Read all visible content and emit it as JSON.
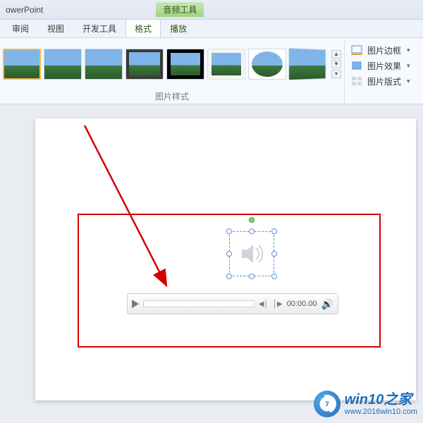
{
  "app_title": "owerPoint",
  "context_tab": "音频工具",
  "tabs": {
    "review": "审阅",
    "view": "视图",
    "dev": "开发工具",
    "format": "格式",
    "playback": "播放"
  },
  "ribbon": {
    "styles_label": "图片样式",
    "opts": {
      "border": "图片边框",
      "effects": "图片效果",
      "layout": "图片版式"
    }
  },
  "audio": {
    "time": "00:00.00"
  },
  "watermark": {
    "title": "win10之家",
    "url": "www.2016win10.com"
  }
}
